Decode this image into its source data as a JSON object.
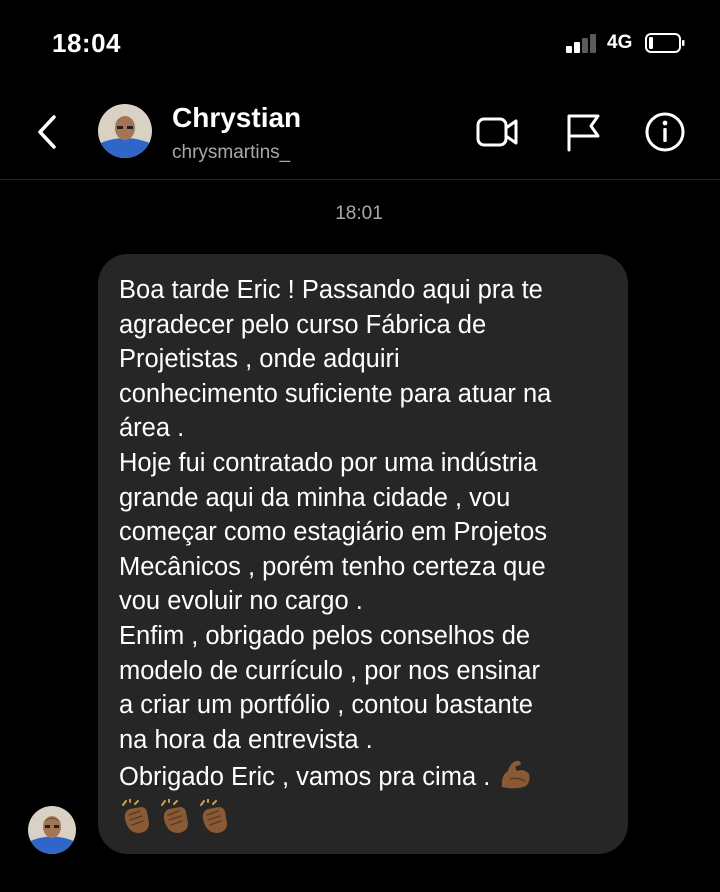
{
  "status_bar": {
    "time": "18:04",
    "network": "4G",
    "signal_bars": 2,
    "signal_total": 4,
    "battery_level": 0.12
  },
  "header": {
    "contact_name": "Chrystian",
    "username": "chrysmartins_"
  },
  "conversation": {
    "timestamp": "18:01",
    "message_lines": [
      "Boa tarde Eric ! Passando aqui pra te",
      "agradecer pelo curso Fábrica de",
      "Projetistas , onde adquiri",
      "conhecimento suficiente para atuar na",
      "área .",
      "Hoje fui contratado por uma indústria",
      "grande aqui da minha cidade , vou",
      "começar como estagiário em Projetos",
      "Mecânicos , porém tenho certeza que",
      "vou evoluir no cargo .",
      "Enfim , obrigado pelos conselhos de",
      "modelo de currículo , por nos ensinar",
      "a criar um portfólio , contou bastante",
      "na hora da entrevista .",
      "Obrigado Eric , vamos pra cima ."
    ],
    "trailing_emoji": "flexed-biceps-emoji",
    "emoji_row": [
      "clapping-hands-emoji",
      "clapping-hands-emoji",
      "clapping-hands-emoji"
    ]
  },
  "colors": {
    "background": "#000000",
    "bubble": "#262626",
    "secondary_text": "#a8a8a8",
    "skin_tone": "#8a5a36"
  }
}
